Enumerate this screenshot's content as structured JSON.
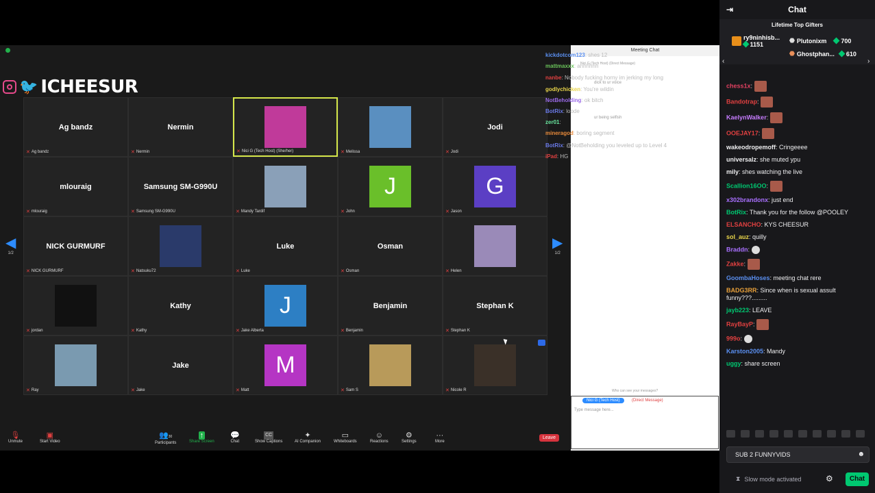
{
  "watermark": "ICHEESUR",
  "zoom": {
    "page_indicator_left": "1/2",
    "page_indicator_right": "1/2",
    "participants": [
      {
        "name": "Ag bandz",
        "label": "Ag bandz",
        "kind": "text"
      },
      {
        "name": "Nermin",
        "label": "Nermin",
        "kind": "text"
      },
      {
        "name": "",
        "label": "Nici G (Tech Host) (She/her)",
        "kind": "photo",
        "active": true,
        "color": "#c03a9a"
      },
      {
        "name": "",
        "label": "Melissa",
        "kind": "photo",
        "color": "#5a8fc0"
      },
      {
        "name": "Jodi",
        "label": "Jodi",
        "kind": "text"
      },
      {
        "name": "mlouraig",
        "label": "mlouraig",
        "kind": "text"
      },
      {
        "name": "Samsung SM-G990U",
        "label": "Samsung SM-G990U",
        "kind": "text"
      },
      {
        "name": "",
        "label": "Mandy Tardif",
        "kind": "photo",
        "color": "#8aa0b8"
      },
      {
        "name": "J",
        "label": "John",
        "kind": "letter",
        "color": "#6abf2a"
      },
      {
        "name": "G",
        "label": "Jason",
        "kind": "letter",
        "color": "#5b3fc4"
      },
      {
        "name": "NICK GURMURF",
        "label": "NICK GURMURF",
        "kind": "text"
      },
      {
        "name": "",
        "label": "Natsuku72",
        "kind": "photo",
        "color": "#2a3a6a"
      },
      {
        "name": "Luke",
        "label": "Luke",
        "kind": "text"
      },
      {
        "name": "Osman",
        "label": "Osman",
        "kind": "text"
      },
      {
        "name": "",
        "label": "Helen",
        "kind": "photo",
        "color": "#9a8ab8"
      },
      {
        "name": "",
        "label": "jordan",
        "kind": "photo",
        "color": "#111111"
      },
      {
        "name": "Kathy",
        "label": "Kathy",
        "kind": "text"
      },
      {
        "name": "J",
        "label": "Jake Alberta",
        "kind": "letter",
        "color": "#2d7fc4"
      },
      {
        "name": "Benjamin",
        "label": "Benjamin",
        "kind": "text"
      },
      {
        "name": "Stephan K",
        "label": "Stephan K",
        "kind": "text"
      },
      {
        "name": "",
        "label": "Ray",
        "kind": "photo",
        "color": "#7a9ab0"
      },
      {
        "name": "Jake",
        "label": "Jake",
        "kind": "text"
      },
      {
        "name": "M",
        "label": "Matt",
        "kind": "letter",
        "color": "#b535c4"
      },
      {
        "name": "",
        "label": "Sam S",
        "kind": "photo",
        "color": "#b89a5a"
      },
      {
        "name": "",
        "label": "Nicole R",
        "kind": "photo",
        "color": "#3a3028"
      }
    ],
    "toolbar": {
      "unmute": "Unmute",
      "start_video": "Start Video",
      "participants": "Participants",
      "participants_count": "30",
      "share_screen": "Share Screen",
      "chat": "Chat",
      "show_captions": "Show Captions",
      "cc": "CC",
      "ai_companion": "AI Companion",
      "whiteboards": "Whiteboards",
      "reactions": "Reactions",
      "settings": "Settings",
      "more": "More",
      "leave": "Leave"
    },
    "meeting_chat": {
      "title": "Meeting Chat",
      "recipient": "Nici G (Tech Host)",
      "direct_message": "(Direct Message)",
      "placeholder": "Type message here...",
      "who_can_see": "Who can see your messages?"
    }
  },
  "stream_overlay_chat": [
    {
      "user": "kickdotcom123",
      "text": ": shes 12",
      "color": "#5a8ff0"
    },
    {
      "user": "mattmaxxx",
      "text": ": ahhhhhh",
      "color": "#6ac45a"
    },
    {
      "user": "nanbe",
      "text": ": Nobody fucking horny im jerking my long",
      "color": "#e04040"
    },
    {
      "user": "godlychicken",
      "text": ": You're wildin",
      "color": "#e8d44a"
    },
    {
      "user": "NotBeholding",
      "text": ": ok bitch",
      "color": "#9a6ae8"
    },
    {
      "user": "BotRix",
      "text": ": loode",
      "color": "#6a7ae8"
    },
    {
      "user": "zer01",
      "text": ":",
      "color": "#6ae8a0"
    },
    {
      "user": "mineragod",
      "text": ": boring segment",
      "color": "#e88a3a"
    },
    {
      "user": "BotRix",
      "text": ": @NotBeholding you leveled up to Level 4",
      "color": "#6a7ae8"
    },
    {
      "user": "iPad",
      "text": ": HG",
      "color": "#e04040"
    }
  ],
  "overlay_snips": {
    "mc_top_note": "ur being selfish",
    "mc_top_note2": "dick to ur voice",
    "mc_dm": "Nici G (Tech Host) (Direct Message)"
  },
  "twitch": {
    "title": "Chat",
    "gifters_title": "Lifetime Top Gifters",
    "gifters": [
      {
        "name": "ry9ninhisb...",
        "count": "1151"
      },
      {
        "name": "Plutonixm",
        "count": "700"
      },
      {
        "name": "Ghostphan...",
        "count": "610"
      }
    ],
    "messages": [
      {
        "user": "chess1x",
        "text": ":",
        "color": "#e04060",
        "emote": true
      },
      {
        "user": "Bandotrap",
        "text": ":",
        "color": "#e04040",
        "emote": true
      },
      {
        "user": "KaelynWalker",
        "text": ":",
        "color": "#c77dff",
        "emote": true
      },
      {
        "user": "OOEJAY17",
        "text": ":",
        "color": "#e04040",
        "emote": true
      },
      {
        "user": "wakeodropemoff",
        "text": ": Cringeeee",
        "color": "#efeff1"
      },
      {
        "user": "universalz",
        "text": ": she muted ypu",
        "color": "#efeff1"
      },
      {
        "user": "mily",
        "text": ": shes watching the live",
        "color": "#efeff1"
      },
      {
        "user": "Scallion16OO",
        "text": ":",
        "color": "#00c871",
        "emote": true
      },
      {
        "user": "x302brandonx",
        "text": ": just end",
        "color": "#a970ff"
      },
      {
        "user": "BotRix",
        "text": ": Thank you for the follow @POOLEY",
        "color": "#00c871"
      },
      {
        "user": "ELSANCHO",
        "text": ": KYS CHEESUR",
        "color": "#e04040"
      },
      {
        "user": "sol_auz",
        "text": ": quilly",
        "color": "#e8d44a"
      },
      {
        "user": "Braddn",
        "text": ":",
        "color": "#a970ff",
        "skull": true
      },
      {
        "user": "Zakke",
        "text": ":",
        "color": "#e04040",
        "emote": true
      },
      {
        "user": "GoombaHoses",
        "text": ": meeting chat rere",
        "color": "#5a8ff0"
      },
      {
        "user": "BADG3RR",
        "text": ": Since when is sexual assult funny???.........",
        "color": "#e8a03a"
      },
      {
        "user": "jayb223",
        "text": ": LEAVE",
        "color": "#00c871"
      },
      {
        "user": "RayBayP",
        "text": ":",
        "color": "#e04040",
        "emote": true
      },
      {
        "user": "999o",
        "text": ":",
        "color": "#e04040",
        "skull": true
      },
      {
        "user": "Karston2005",
        "text": ": Mandy",
        "color": "#5a8ff0"
      },
      {
        "user": "uggy",
        "text": ": share screen",
        "color": "#00c871"
      }
    ],
    "input_value": "SUB 2 FUNNYVIDS",
    "slow_mode": "Slow mode activated",
    "chat_button": "Chat"
  }
}
